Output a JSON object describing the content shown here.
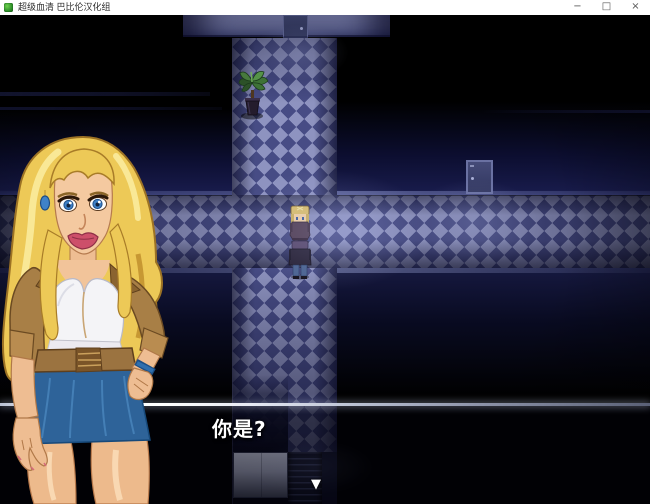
{
  "window": {
    "title": "超级血清 巴比伦汉化组",
    "controls": {
      "minimize": "−",
      "maximize": "□",
      "close": "×"
    }
  },
  "dialogue": {
    "text": "你是?",
    "continue_glyph": "▼"
  },
  "scene": {
    "colors": {
      "checker_light": "#8e93c0",
      "checker_dark": "#474c85",
      "wall_navy": "#171a49",
      "door": "#3b4170",
      "light_glow": "#bec8ff"
    },
    "sprites": [
      "blonde-npc-facing-down",
      "player-facing-up"
    ],
    "objects": [
      "potted-plant",
      "door-top-wall",
      "door-right-wall",
      "elevator-panel",
      "stairs-down"
    ]
  },
  "portrait": {
    "character": "blonde-woman",
    "colors": {
      "hair": "#edc957",
      "skin": "#f2c49a",
      "jacket": "#a87f46",
      "top": "#f4f4f7",
      "skirt": "#2e6399",
      "lips": "#cd4f6a",
      "eyes": "#3f82c8"
    }
  }
}
